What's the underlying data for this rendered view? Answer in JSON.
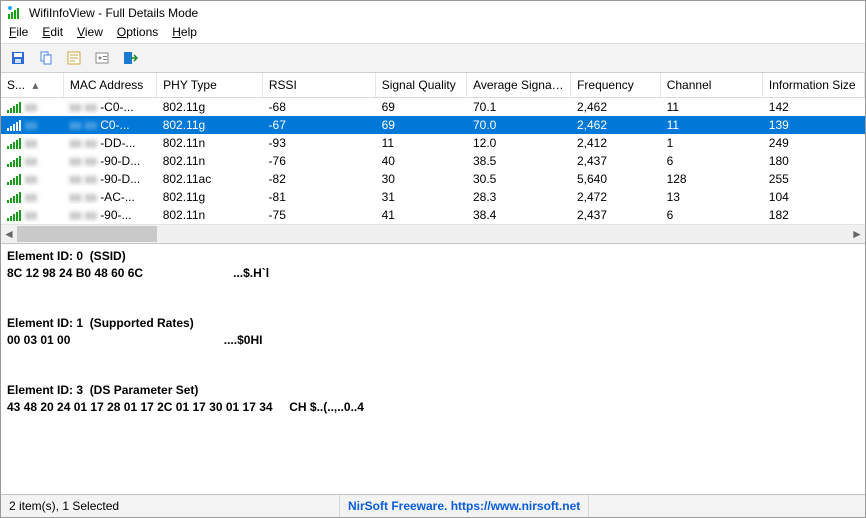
{
  "window": {
    "title": "WifiInfoView  -  Full Details Mode"
  },
  "menu": {
    "file": {
      "label": "File",
      "ul": "F"
    },
    "edit": {
      "label": "Edit",
      "ul": "E"
    },
    "view": {
      "label": "View",
      "ul": "V"
    },
    "options": {
      "label": "Options",
      "ul": "O"
    },
    "help": {
      "label": "Help",
      "ul": "H"
    }
  },
  "toolbar": {
    "icons": [
      "save-icon",
      "copy-icon",
      "properties-icon",
      "options-icon",
      "exit-icon"
    ]
  },
  "columns": {
    "ssid": "S...",
    "mac": "MAC Address",
    "phy": "PHY Type",
    "rssi": "RSSI",
    "sq": "Signal Quality",
    "avg": "Average Signal...",
    "freq": "Frequency",
    "ch": "Channel",
    "info": "Information Size"
  },
  "rows": [
    {
      "mac_suffix": "-C0-...",
      "phy": "802.11g",
      "rssi": "-68",
      "sq": "69",
      "avg": "70.1",
      "freq": "2,462",
      "ch": "11",
      "info": "142",
      "selected": false
    },
    {
      "mac_suffix": "C0-...",
      "phy": "802.11g",
      "rssi": "-67",
      "sq": "69",
      "avg": "70.0",
      "freq": "2,462",
      "ch": "11",
      "info": "139",
      "selected": true
    },
    {
      "mac_suffix": "-DD-...",
      "phy": "802.11n",
      "rssi": "-93",
      "sq": "11",
      "avg": "12.0",
      "freq": "2,412",
      "ch": "1",
      "info": "249",
      "selected": false
    },
    {
      "mac_suffix": "-90-D...",
      "phy": "802.11n",
      "rssi": "-76",
      "sq": "40",
      "avg": "38.5",
      "freq": "2,437",
      "ch": "6",
      "info": "180",
      "selected": false
    },
    {
      "mac_suffix": "-90-D...",
      "phy": "802.11ac",
      "rssi": "-82",
      "sq": "30",
      "avg": "30.5",
      "freq": "5,640",
      "ch": "128",
      "info": "255",
      "selected": false
    },
    {
      "mac_suffix": "-AC-...",
      "phy": "802.11g",
      "rssi": "-81",
      "sq": "31",
      "avg": "28.3",
      "freq": "2,472",
      "ch": "13",
      "info": "104",
      "selected": false
    },
    {
      "mac_suffix": "-90-...",
      "phy": "802.11n",
      "rssi": "-75",
      "sq": "41",
      "avg": "38.4",
      "freq": "2,437",
      "ch": "6",
      "info": "182",
      "selected": false
    }
  ],
  "details": {
    "line1": "Element ID: 0  (SSID)",
    "line2": "8C 12 98 24 B0 48 60 6C                           ...$.H`l",
    "line3": "",
    "line4": "",
    "line5": "Element ID: 1  (Supported Rates)",
    "line6": "00 03 01 00                                              ....$0HI",
    "line7": "",
    "line8": "",
    "line9": "Element ID: 3  (DS Parameter Set)",
    "line10": "43 48 20 24 01 17 28 01 17 2C 01 17 30 01 17 34     CH $..(..,..0..4"
  },
  "status": {
    "items": "2 item(s), 1 Selected",
    "link": "NirSoft Freeware. https://www.nirsoft.net"
  }
}
